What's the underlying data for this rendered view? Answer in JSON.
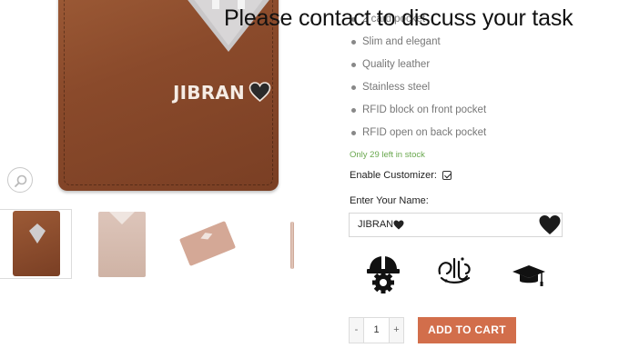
{
  "banner": {
    "text": "Please contact to discuss your task"
  },
  "product": {
    "engraving": "JIBRAN",
    "features": [
      "2 card pocket",
      "Slim and elegant",
      "Quality leather",
      "Stainless steel",
      "RFID block on front pocket",
      "RFID open on back pocket"
    ],
    "stock": "Only 29 left in stock"
  },
  "gallery": {
    "zoom_icon": "search-icon",
    "thumbnails": [
      "front-brown",
      "sleeve-pink",
      "card-pink",
      "edge-view"
    ]
  },
  "customizer": {
    "enable_label": "Enable Customizer:",
    "enabled": true,
    "name_label": "Enter Your Name:",
    "name_value": "JIBRAN",
    "icons": [
      "heart-icon",
      "helmet-gear-icon",
      "arabic-calligraphy-icon",
      "graduation-cap-icon"
    ]
  },
  "cart": {
    "minus": "-",
    "quantity": "1",
    "plus": "+",
    "add_label": "ADD TO CART"
  },
  "colors": {
    "leather": "#8a4a2b",
    "button": "#d26e4b",
    "stock": "#6aa84f"
  }
}
